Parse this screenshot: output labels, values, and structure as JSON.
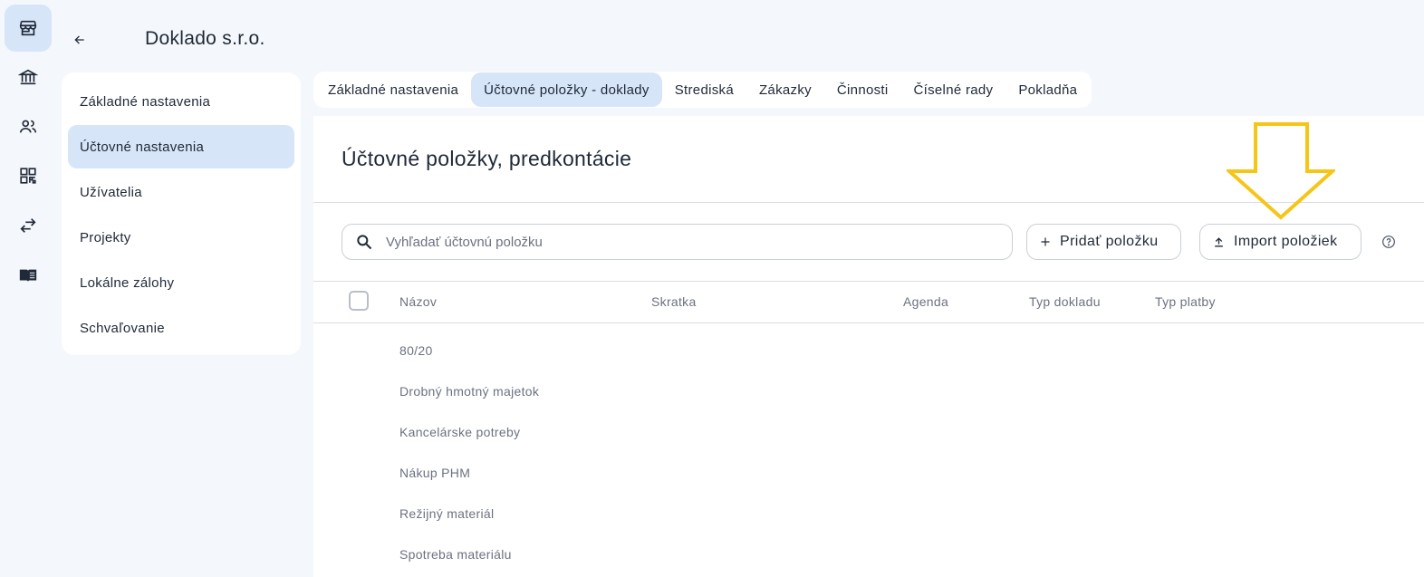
{
  "rail": {
    "items": [
      {
        "icon": "store-icon",
        "active": true
      },
      {
        "icon": "bank-icon",
        "active": false
      },
      {
        "icon": "people-icon",
        "active": false
      },
      {
        "icon": "qr-code-icon",
        "active": false
      },
      {
        "icon": "transfer-icon",
        "active": false
      },
      {
        "icon": "book-icon",
        "active": false
      }
    ]
  },
  "header": {
    "company_name": "Doklado s.r.o."
  },
  "sidebar": {
    "items": [
      {
        "label": "Základné nastavenia"
      },
      {
        "label": "Účtovné nastavenia"
      },
      {
        "label": "Užívatelia"
      },
      {
        "label": "Projekty"
      },
      {
        "label": "Lokálne zálohy"
      },
      {
        "label": "Schvaľovanie"
      }
    ],
    "active_index": 1
  },
  "tabs": [
    {
      "label": "Základné nastavenia"
    },
    {
      "label": "Účtovné položky - doklady"
    },
    {
      "label": "Strediská"
    },
    {
      "label": "Zákazky"
    },
    {
      "label": "Činnosti"
    },
    {
      "label": "Číselné rady"
    },
    {
      "label": "Pokladňa"
    }
  ],
  "active_tab_index": 1,
  "main": {
    "title": "Účtovné položky, predkontácie",
    "search": {
      "placeholder": "Vyhľadať účtovnú položku",
      "value": ""
    },
    "add_button_label": "Pridať položku",
    "import_button_label": "Import položiek",
    "table": {
      "columns": [
        "Názov",
        "Skratka",
        "Agenda",
        "Typ dokladu",
        "Typ platby"
      ],
      "rows": [
        {
          "name": "80/20"
        },
        {
          "name": "Drobný hmotný majetok"
        },
        {
          "name": "Kancelárske potreby"
        },
        {
          "name": "Nákup PHM"
        },
        {
          "name": "Režijný materiál"
        },
        {
          "name": "Spotreba materiálu"
        }
      ]
    }
  },
  "colors": {
    "accent_bg": "#d7e5f8",
    "annotation_arrow": "#f5c518"
  }
}
